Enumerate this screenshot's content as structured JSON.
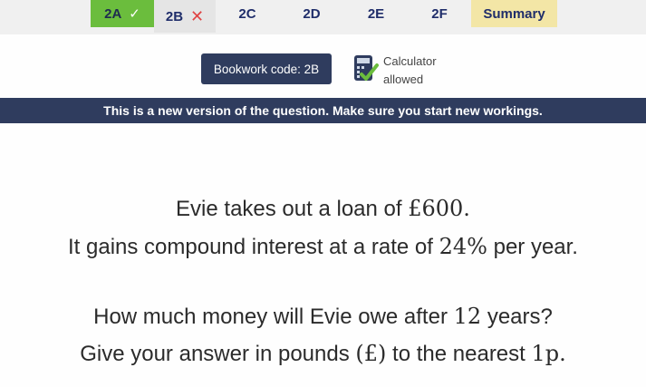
{
  "tabs": [
    {
      "label": "2A",
      "status": "done"
    },
    {
      "label": "2B",
      "status": "wrong"
    },
    {
      "label": "2C",
      "status": "pending"
    },
    {
      "label": "2D",
      "status": "pending"
    },
    {
      "label": "2E",
      "status": "pending"
    },
    {
      "label": "2F",
      "status": "pending"
    },
    {
      "label": "Summary",
      "status": "summary"
    }
  ],
  "marks": {
    "check": "✓",
    "cross": "✕"
  },
  "bookwork": "Bookwork code: 2B",
  "calculator": {
    "line1": "Calculator",
    "line2": "allowed"
  },
  "banner": "This is a new version of the question. Make sure you start new workings.",
  "question": {
    "line1_text": "Evie takes out a loan of ",
    "line1_amount": "£600.",
    "line2_text_a": "It gains compound interest at a rate of ",
    "line2_rate": "24%",
    "line2_text_b": " per year.",
    "line3_text_a": "How much money will Evie owe after ",
    "line3_years": "12",
    "line3_text_b": " years?",
    "line4_text_a": "Give your answer in pounds ",
    "line4_unit": "(£)",
    "line4_text_b": " to the nearest ",
    "line4_precision": "1p."
  },
  "colors": {
    "done": "#6bbd3d",
    "wrong_x": "#e04343",
    "navy": "#2f3c5e",
    "summary": "#f3e6a6"
  }
}
